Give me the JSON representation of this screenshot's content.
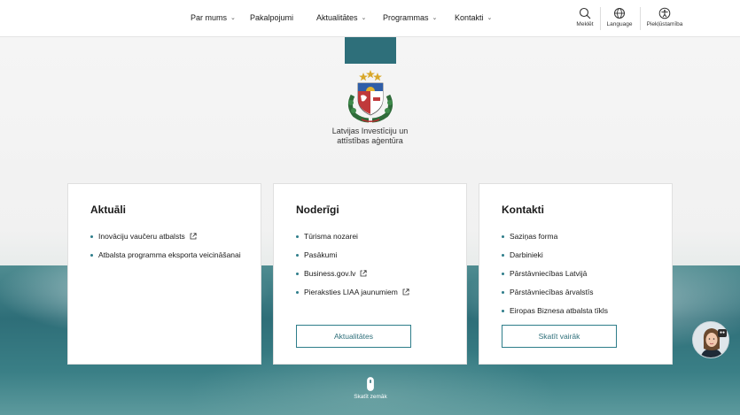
{
  "nav": {
    "items": [
      {
        "label": "Par mums",
        "has_dropdown": true
      },
      {
        "label": "Pakalpojumi",
        "has_dropdown": false
      },
      {
        "label": "Aktualitātes",
        "has_dropdown": true
      },
      {
        "label": "Programmas",
        "has_dropdown": true
      },
      {
        "label": "Kontakti",
        "has_dropdown": true
      }
    ],
    "utilities": [
      {
        "label": "Meklēt",
        "icon": "search-icon"
      },
      {
        "label": "Language",
        "icon": "globe-icon"
      },
      {
        "label": "Piekļūstamība",
        "icon": "accessibility-icon"
      }
    ]
  },
  "header": {
    "org_name_line1": "Latvijas Investīciju un",
    "org_name_line2": "attīstības aģentūra"
  },
  "cards": [
    {
      "title": "Aktuāli",
      "items": [
        {
          "label": "Inovāciju vaučeru atbalsts",
          "external": true
        },
        {
          "label": "Atbalsta programma eksporta veicināšanai",
          "external": false
        }
      ]
    },
    {
      "title": "Noderīgi",
      "items": [
        {
          "label": "Tūrisma nozarei",
          "external": false
        },
        {
          "label": "Pasākumi",
          "external": false
        },
        {
          "label": "Business.gov.lv",
          "external": true
        },
        {
          "label": "Pieraksties LIAA jaunumiem",
          "external": true
        }
      ],
      "button": "Aktualitātes"
    },
    {
      "title": "Kontakti",
      "items": [
        {
          "label": "Saziņas forma",
          "external": false
        },
        {
          "label": "Darbinieki",
          "external": false
        },
        {
          "label": "Pārstāvniecības Latvijā",
          "external": false
        },
        {
          "label": "Pārstāvniecības ārvalstīs",
          "external": false
        },
        {
          "label": "Eiropas Biznesa atbalsta tīkls",
          "external": false
        }
      ],
      "button": "Skatīt vairāk"
    }
  ],
  "scroll_hint": {
    "label": "Skatīt zemāk",
    "icon": "mouse-scroll-icon"
  },
  "chat": {
    "icon": "chat-assistant-avatar"
  },
  "colors": {
    "accent": "#2e7d8a",
    "teal_block": "#2e6f7a"
  }
}
